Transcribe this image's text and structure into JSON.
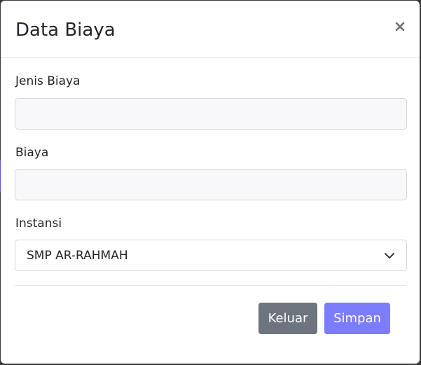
{
  "modal": {
    "title": "Data Biaya",
    "close_icon": "close-icon"
  },
  "form": {
    "jenis_biaya": {
      "label": "Jenis Biaya",
      "value": ""
    },
    "biaya": {
      "label": "Biaya",
      "value": ""
    },
    "instansi": {
      "label": "Instansi",
      "selected": "SMP AR-RAHMAH"
    }
  },
  "footer": {
    "keluar_label": "Keluar",
    "simpan_label": "Simpan"
  },
  "colors": {
    "primary": "#7c7cff",
    "secondary": "#6c757d",
    "input_bg": "#f8f8fa"
  }
}
